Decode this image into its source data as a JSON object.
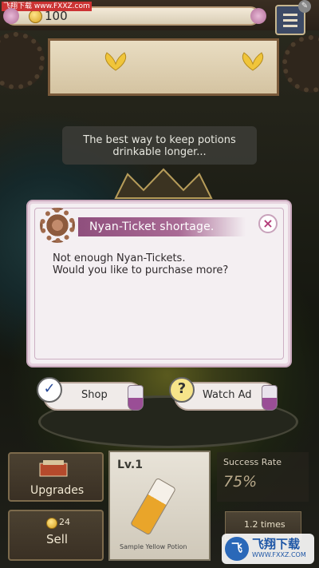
{
  "hud": {
    "coins": "100",
    "watermark_top": "飞翔下载 www.FXXZ.com"
  },
  "tip": {
    "text_line1": "The best way to keep potions",
    "text_line2": "drinkable longer..."
  },
  "dialog": {
    "title": "Nyan-Ticket shortage.",
    "message_line1": "Not enough Nyan-Tickets.",
    "message_line2": "Would you like to purchase more?",
    "shop_label": "Shop",
    "watch_ad_label": "Watch Ad",
    "close_symbol": "×"
  },
  "bottom": {
    "upgrades_label": "Upgrades",
    "sell_price": "24",
    "sell_label": "Sell",
    "card_level": "Lv.1",
    "card_name": "Sample Yellow Potion",
    "success_rate_title": "Success Rate",
    "success_rate_value": "75%",
    "times_label": "1.2 times"
  },
  "watermark": {
    "logo_text": "飞翔下载",
    "url": "WWW.FXXZ.COM",
    "logo_glyph": "飞"
  },
  "colors": {
    "dialog_title_bar": "#8f4f7d",
    "coin": "#d6a020",
    "potion": "#e9a52a"
  },
  "icons": {
    "shop": "check-icon",
    "watch_ad": "question-icon",
    "close": "close-icon"
  }
}
